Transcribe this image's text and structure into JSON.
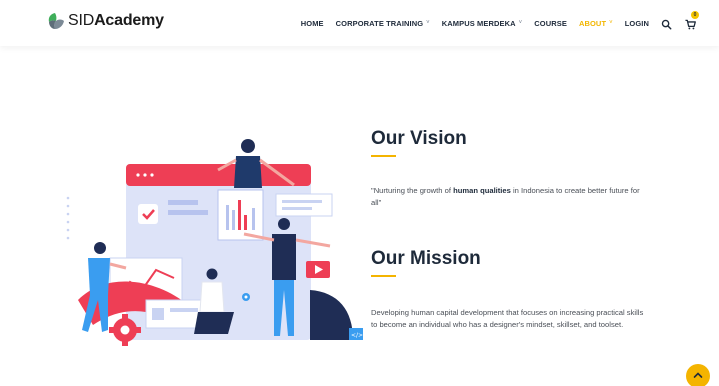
{
  "brand": {
    "sid": "SID",
    "academy": "Academy",
    "colors": {
      "green": "#3fae5a",
      "gray": "#7c8a96"
    }
  },
  "nav": {
    "items": [
      {
        "label": "HOME",
        "has_caret": false,
        "active": false
      },
      {
        "label": "CORPORATE TRAINING",
        "has_caret": true,
        "active": false
      },
      {
        "label": "KAMPUS MERDEKA",
        "has_caret": true,
        "active": false
      },
      {
        "label": "COURSE",
        "has_caret": false,
        "active": false
      },
      {
        "label": "ABOUT",
        "has_caret": true,
        "active": true
      },
      {
        "label": "LOGIN",
        "has_caret": false,
        "active": false
      }
    ],
    "caret_glyph": "˅",
    "search_icon": "search-icon",
    "cart_icon": "cart-icon",
    "cart_count": "0"
  },
  "vision": {
    "title": "Our Vision",
    "text_before": "\"Nurturing the growth of ",
    "text_bold": "human qualities",
    "text_after": " in Indonesia to create better future for all\""
  },
  "mission": {
    "title": "Our Mission",
    "text": "Developing human capital development that focuses on increasing practical skills to become an individual who has a designer's mindset, skillset, and toolset."
  },
  "colors": {
    "accent": "#f4b400",
    "active_nav": "#f2b600",
    "heading": "#1e2a3a",
    "illustration_red": "#ee3e55",
    "illustration_blue": "#c9d3f2"
  },
  "back_to_top_icon": "chevron-up-icon"
}
